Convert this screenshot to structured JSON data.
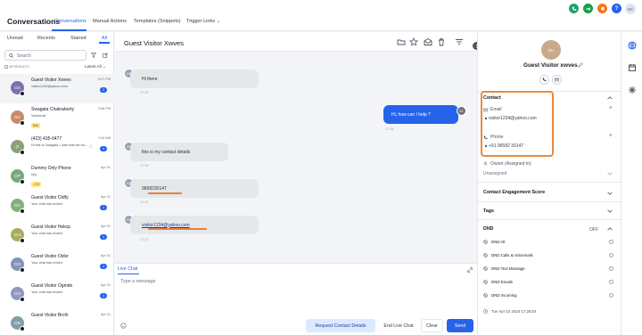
{
  "app_title": "Conversations",
  "nav_tabs": [
    "Conversations",
    "Manual Actions",
    "Templates (Snippets)",
    "Trigger Links"
  ],
  "header_icons": [
    {
      "name": "phone-icon",
      "color": "#22a06b"
    },
    {
      "name": "megaphone-icon",
      "color": "#16a34a"
    },
    {
      "name": "bell-icon",
      "color": "#f97316"
    },
    {
      "name": "help-icon",
      "color": "#2563eb",
      "text": "?"
    },
    {
      "name": "account-avatar",
      "text": "SC"
    }
  ],
  "filters": {
    "tabs": [
      "Unread",
      "Recents",
      "Starred",
      "All"
    ],
    "active": "All"
  },
  "search": {
    "placeholder": "Search"
  },
  "results_label": "49 RESULTS",
  "sort_label": "Latest All",
  "conversations": [
    {
      "name": "Guest Visitor Xwves",
      "preview": "visitor1234@yahoo.com",
      "time": "5:27 PM",
      "count": "3",
      "initials": "GX",
      "color": "#7c6fb0"
    },
    {
      "name": "Swagata Chakraborty",
      "preview": "Voicemail",
      "time": "3:58 PM",
      "initials": "SC",
      "color": "#c88a69",
      "tag": "$48"
    },
    {
      "name": "(423) 435-0477",
      "preview": "Hi this is Swagata, I saw that we ha...",
      "time": "1:54 AM",
      "count": "4",
      "initials": "(4",
      "color": "#8aa17a"
    },
    {
      "name": "Dummy Only Phone",
      "preview": "hey",
      "time": "Apr 01",
      "initials": "DP",
      "color": "#79a97d",
      "tag": "-170"
    },
    {
      "name": "Guest Visitor Ctdfy",
      "preview": "Your chat has ended",
      "time": "Apr 01",
      "count": "1",
      "initials": "GC",
      "color": "#82b27a"
    },
    {
      "name": "Guest Visitor Hekcp",
      "preview": "Your chat has ended",
      "time": "Apr 01",
      "count": "1",
      "initials": "GH",
      "color": "#a7ad5b"
    },
    {
      "name": "Guest Visitor Oidvr",
      "preview": "Your chat has ended",
      "time": "Apr 01",
      "count": "1",
      "initials": "GO",
      "color": "#8593b8"
    },
    {
      "name": "Guest Visitor Ogmdo",
      "preview": "Your chat has ended",
      "time": "Apr 01",
      "count": "1",
      "initials": "GO",
      "color": "#8f96c1"
    },
    {
      "name": "Guest Visitor Brcth",
      "preview": "",
      "time": "Apr 01",
      "initials": "GB",
      "color": "#7f9fa9"
    }
  ],
  "chat": {
    "title": "Guest Visitor Xwves",
    "messages": [
      {
        "text": "Hi there",
        "time": "17:28",
        "dir": "in"
      },
      {
        "text": "Hi, how can I help ?",
        "time": "17:28",
        "dir": "out"
      },
      {
        "text": "this is my contact details",
        "time": "17:26",
        "dir": "in"
      },
      {
        "text": "9658230147",
        "time": "17:27",
        "dir": "in"
      },
      {
        "text": "visitor1234@yahoo.com",
        "time": "17:27",
        "dir": "in"
      }
    ],
    "agent_initials": "SC"
  },
  "composer": {
    "tab": "Live Chat",
    "placeholder": "Type a message",
    "buttons": {
      "request": "Request Contact Details",
      "end": "End Live Chat",
      "clear": "Clear",
      "send": "Send"
    }
  },
  "contact": {
    "initials": "GU",
    "name": "Guest Visitor xwves",
    "section": "Contact",
    "email_label": "Email",
    "email": "visitor1234@yahoo.com",
    "phone_label": "Phone",
    "phone": "+91 96582 30147",
    "owner_label": "Owner (Assigned to)",
    "owner_value": "Unassigned",
    "engagement": "Contact Engagement Score",
    "tags": "Tags",
    "dnd": "DND",
    "dnd_state": "OFF",
    "dnd_items": [
      "DND All",
      "DND Calls & Voicemails",
      "DND Text Message",
      "DND Emails",
      "DND Incoming"
    ],
    "timestamp": "Tue Apr 02 2024 17:28:04"
  },
  "colors": {
    "accent": "#2563eb",
    "highlight": "#eb8a3e"
  }
}
